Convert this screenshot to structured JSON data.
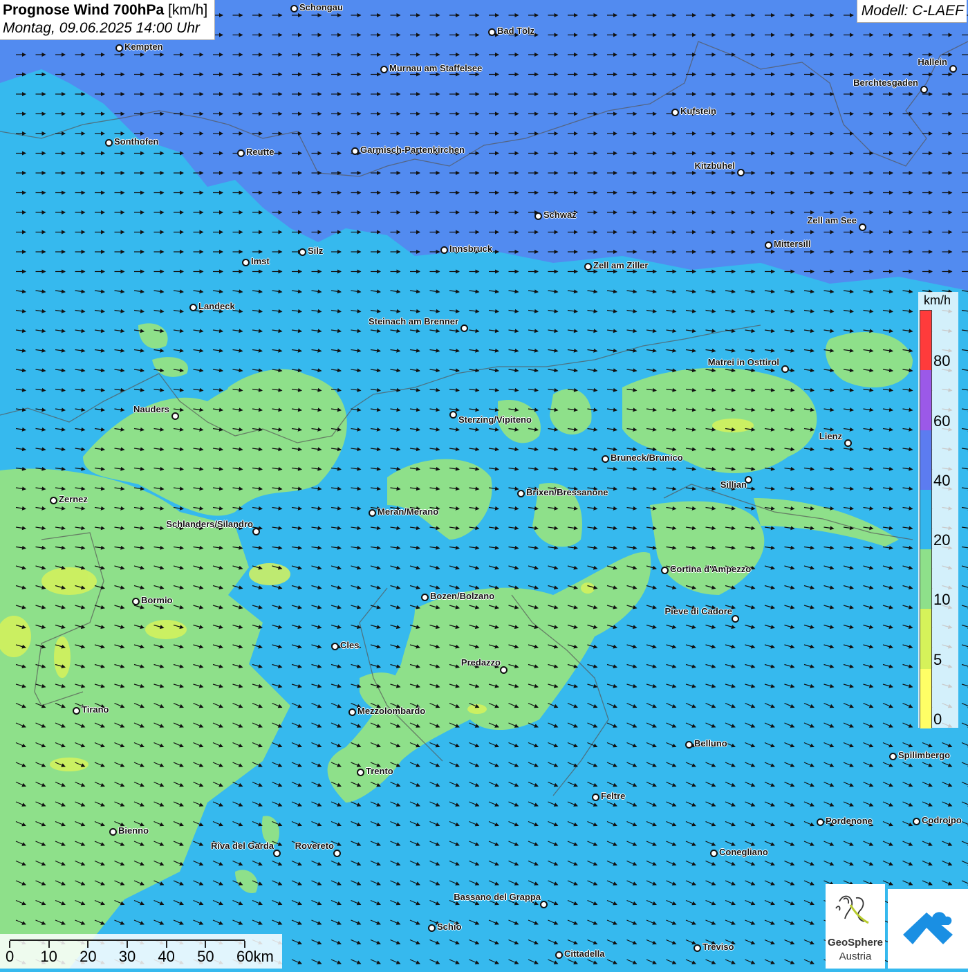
{
  "title": {
    "main": "Prognose Wind 700hPa",
    "unit": "[km/h]",
    "datetime": "Montag, 09.06.2025 14:00 Uhr"
  },
  "model": "Modell: C-LAEF",
  "legend": {
    "unit": "km/h",
    "ticks": [
      "80",
      "60",
      "40",
      "20",
      "10",
      "5",
      "0"
    ],
    "colors": [
      "#ff3b3b",
      "#9b59e8",
      "#5c7cf0",
      "#33b6ee",
      "#8ee08a",
      "#d6f25a",
      "#ffff66"
    ]
  },
  "cities": [
    {
      "name": "Schongau"
    },
    {
      "name": "Bad Tölz"
    },
    {
      "name": "Kempten"
    },
    {
      "name": "Murnau am Staffelsee"
    },
    {
      "name": "Hallein"
    },
    {
      "name": "Berchtesgaden"
    },
    {
      "name": "Kufstein"
    },
    {
      "name": "Sonthofen"
    },
    {
      "name": "Reutte"
    },
    {
      "name": "Garmisch-Partenkirchen"
    },
    {
      "name": "Kitzbühel"
    },
    {
      "name": "Schwaz"
    },
    {
      "name": "Zell am See"
    },
    {
      "name": "Mittersill"
    },
    {
      "name": "Innsbruck"
    },
    {
      "name": "Silz"
    },
    {
      "name": "Imst"
    },
    {
      "name": "Zell am Ziller"
    },
    {
      "name": "Landeck"
    },
    {
      "name": "Steinach am Brenner"
    },
    {
      "name": "Matrei in Osttirol"
    },
    {
      "name": "Nauders"
    },
    {
      "name": "Sterzing/Vipiteno"
    },
    {
      "name": "Lienz"
    },
    {
      "name": "Bruneck/Brunico"
    },
    {
      "name": "Sillian"
    },
    {
      "name": "Brixen/Bressanone"
    },
    {
      "name": "Zernez"
    },
    {
      "name": "Meran/Merano"
    },
    {
      "name": "Schlanders/Silandro"
    },
    {
      "name": "Cortina d'Ampezzo"
    },
    {
      "name": "Bozen/Bolzano"
    },
    {
      "name": "Bormio"
    },
    {
      "name": "Pieve di Cadore"
    },
    {
      "name": "Cles"
    },
    {
      "name": "Predazzo"
    },
    {
      "name": "Tirano"
    },
    {
      "name": "Mezzolombardo"
    },
    {
      "name": "Belluno"
    },
    {
      "name": "Spilimbergo"
    },
    {
      "name": "Trento"
    },
    {
      "name": "Feltre"
    },
    {
      "name": "Pordenone"
    },
    {
      "name": "Codroipo"
    },
    {
      "name": "Bienno"
    },
    {
      "name": "Riva del Garda"
    },
    {
      "name": "Rovereto"
    },
    {
      "name": "Conegliano"
    },
    {
      "name": "Bassano del Grappa"
    },
    {
      "name": "Schio"
    },
    {
      "name": "Treviso"
    },
    {
      "name": "Cittadella"
    }
  ],
  "scale": {
    "labels": [
      "0",
      "10",
      "20",
      "30",
      "40",
      "50",
      "60km"
    ]
  },
  "logo": {
    "name": "GeoSphere",
    "sub": "Austria"
  }
}
